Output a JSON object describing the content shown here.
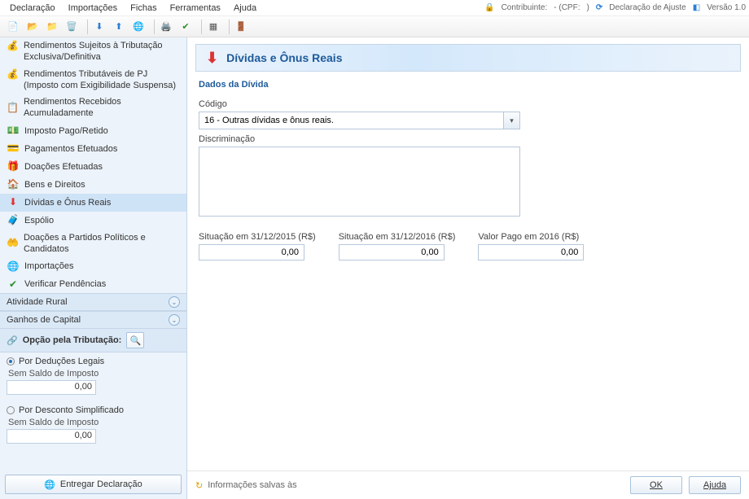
{
  "menu": {
    "items": [
      "Declaração",
      "Importações",
      "Fichas",
      "Ferramentas",
      "Ajuda"
    ],
    "contribuinte_label": "Contribuinte:",
    "cpf_label": "- (CPF:",
    "cpf_close": ")",
    "decl_type": "Declaração de Ajuste",
    "version": "Versão 1.0"
  },
  "sidebar": {
    "items": [
      {
        "label": "Rendimentos Sujeitos à Tributação Exclusiva/Definitiva",
        "icon": "money-icon"
      },
      {
        "label": "Rendimentos Tributáveis de PJ (Imposto com Exigibilidade Suspensa)",
        "icon": "money-lock-icon"
      },
      {
        "label": "Rendimentos Recebidos Acumuladamente",
        "icon": "list-icon"
      },
      {
        "label": "Imposto Pago/Retido",
        "icon": "tax-icon"
      },
      {
        "label": "Pagamentos Efetuados",
        "icon": "card-icon"
      },
      {
        "label": "Doações Efetuadas",
        "icon": "gift-icon"
      },
      {
        "label": "Bens e Direitos",
        "icon": "house-icon"
      },
      {
        "label": "Dívidas e Ônus Reais",
        "icon": "arrow-down-icon",
        "selected": true
      },
      {
        "label": "Espólio",
        "icon": "chest-icon"
      },
      {
        "label": "Doações a Partidos Políticos e Candidatos",
        "icon": "hand-icon"
      },
      {
        "label": "Importações",
        "icon": "globe-icon"
      },
      {
        "label": "Verificar Pendências",
        "icon": "check-icon"
      }
    ],
    "rural": "Atividade Rural",
    "ganhos": "Ganhos de Capital",
    "opt_label": "Opção pela Tributação:",
    "radio1": "Por Deduções Legais",
    "balance_label": "Sem Saldo de Imposto",
    "balance_value": "0,00",
    "radio2": "Por Desconto Simplificado",
    "deliver": "Entregar Declaração"
  },
  "panel": {
    "title": "Dívidas e Ônus Reais",
    "section": "Dados da Dívida",
    "codigo_label": "Código",
    "codigo_value": "16 - Outras dívidas e ônus reais.",
    "discr_label": "Discriminação",
    "col1_label": "Situação em 31/12/2015 (R$)",
    "col2_label": "Situação em 31/12/2016 (R$)",
    "col3_label": "Valor Pago em 2016 (R$)",
    "col1_value": "0,00",
    "col2_value": "0,00",
    "col3_value": "0,00"
  },
  "footer": {
    "info": "Informações salvas às",
    "ok": "OK",
    "help": "Ajuda"
  }
}
